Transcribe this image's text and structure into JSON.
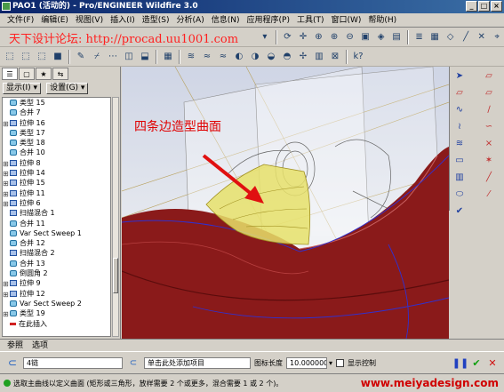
{
  "window": {
    "title": "PAO1 (活动的) - Pro/ENGINEER Wildfire 3.0"
  },
  "menu": [
    "文件(F)",
    "编辑(E)",
    "视图(V)",
    "插入(I)",
    "造型(S)",
    "分析(A)",
    "信息(N)",
    "应用程序(P)",
    "工具(T)",
    "窗口(W)",
    "帮助(H)"
  ],
  "watermark": "天下设计论坛: http://procad.uu1001.com",
  "panel": {
    "show_label": "显示(I) ▾",
    "settings_label": "设置(G) ▾"
  },
  "tree": [
    {
      "label": "类型 15",
      "exp": ""
    },
    {
      "label": "合并 7",
      "exp": ""
    },
    {
      "label": "拉伸 16",
      "exp": "⊞"
    },
    {
      "label": "类型 17",
      "exp": ""
    },
    {
      "label": "类型 18",
      "exp": ""
    },
    {
      "label": "合并 10",
      "exp": ""
    },
    {
      "label": "拉伸 8",
      "exp": "⊞"
    },
    {
      "label": "拉伸 14",
      "exp": "⊞"
    },
    {
      "label": "拉伸 15",
      "exp": "⊞"
    },
    {
      "label": "拉伸 11",
      "exp": "⊞"
    },
    {
      "label": "拉伸 6",
      "exp": "⊞"
    },
    {
      "label": "扫描混合 1",
      "exp": ""
    },
    {
      "label": "合并 11",
      "exp": ""
    },
    {
      "label": "Var Sect Sweep 1",
      "exp": ""
    },
    {
      "label": "合并 12",
      "exp": ""
    },
    {
      "label": "扫描混合 2",
      "exp": ""
    },
    {
      "label": "合并 13",
      "exp": ""
    },
    {
      "label": "倒圆角 2",
      "exp": ""
    },
    {
      "label": "拉伸 9",
      "exp": "⊞"
    },
    {
      "label": "拉伸 12",
      "exp": "⊞"
    },
    {
      "label": "Var Sect Sweep 2",
      "exp": ""
    },
    {
      "label": "类型 19",
      "exp": "⊞"
    },
    {
      "label": "在此插入",
      "exp": ""
    },
    {
      "label": "",
      "exp": ""
    }
  ],
  "viewport": {
    "annotation": "四条边造型曲面"
  },
  "bottom_tabs": [
    "参照",
    "选项"
  ],
  "dashboard": {
    "chain_value": "4链",
    "add_item_value": "单击此处添加项目",
    "length_label": "图标长度",
    "length_value": "10.000000",
    "preview_label": "显示控制"
  },
  "status": {
    "message": "选取主曲线以定义曲面 (矩形或三角形，放样需要 2 个或更多，混合需要 1 或 2 个)。"
  },
  "site_url": "www.meiyadesign.com",
  "colors": {
    "car_body": "#8a1a1a",
    "surface_patch": "#e6e06a",
    "annotation": "#e00000",
    "watermark": "#ff2020"
  }
}
